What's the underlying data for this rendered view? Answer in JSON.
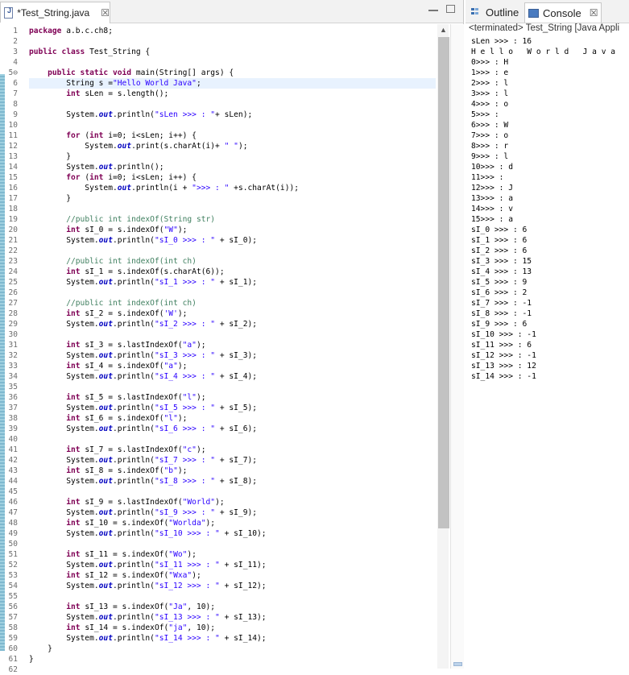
{
  "editor": {
    "tab_title": "*Test_String.java",
    "tab_close": "☒",
    "line_numbers": [
      "1",
      "2",
      "3",
      "4",
      "5⊖",
      "6",
      "7",
      "8",
      "9",
      "10",
      "11",
      "12",
      "13",
      "14",
      "15",
      "16",
      "17",
      "18",
      "19",
      "20",
      "21",
      "22",
      "23",
      "24",
      "25",
      "26",
      "27",
      "28",
      "29",
      "30",
      "31",
      "32",
      "33",
      "34",
      "35",
      "36",
      "37",
      "38",
      "39",
      "40",
      "41",
      "42",
      "43",
      "44",
      "45",
      "46",
      "47",
      "48",
      "49",
      "50",
      "51",
      "52",
      "53",
      "54",
      "55",
      "56",
      "57",
      "58",
      "59",
      "60",
      "61",
      "62"
    ],
    "lines": [
      [
        {
          "t": "package",
          "c": "kw"
        },
        {
          "t": " a.b.c.ch8;"
        }
      ],
      [],
      [
        {
          "t": "public",
          "c": "kw"
        },
        {
          "t": " "
        },
        {
          "t": "class",
          "c": "kw"
        },
        {
          "t": " Test_String {"
        }
      ],
      [],
      [
        {
          "t": "    "
        },
        {
          "t": "public",
          "c": "kw"
        },
        {
          "t": " "
        },
        {
          "t": "static",
          "c": "kw"
        },
        {
          "t": " "
        },
        {
          "t": "void",
          "c": "kw"
        },
        {
          "t": " main(String[] args) {"
        }
      ],
      [
        {
          "t": "        String s ="
        },
        {
          "t": "\"Hello World Java\"",
          "c": "str"
        },
        {
          "t": ";"
        }
      ],
      [
        {
          "t": "        "
        },
        {
          "t": "int",
          "c": "kw"
        },
        {
          "t": " sLen = s.length();"
        }
      ],
      [],
      [
        {
          "t": "        System."
        },
        {
          "t": "out",
          "c": "it"
        },
        {
          "t": ".println("
        },
        {
          "t": "\"sLen >>> : \"",
          "c": "str"
        },
        {
          "t": "+ sLen);"
        }
      ],
      [],
      [
        {
          "t": "        "
        },
        {
          "t": "for",
          "c": "kw"
        },
        {
          "t": " ("
        },
        {
          "t": "int",
          "c": "kw"
        },
        {
          "t": " i=0; i<sLen; i++) {"
        }
      ],
      [
        {
          "t": "            System."
        },
        {
          "t": "out",
          "c": "it"
        },
        {
          "t": ".print(s.charAt(i)+ "
        },
        {
          "t": "\" \"",
          "c": "str"
        },
        {
          "t": ");"
        }
      ],
      [
        {
          "t": "        }"
        }
      ],
      [
        {
          "t": "        System."
        },
        {
          "t": "out",
          "c": "it"
        },
        {
          "t": ".println();"
        }
      ],
      [
        {
          "t": "        "
        },
        {
          "t": "for",
          "c": "kw"
        },
        {
          "t": " ("
        },
        {
          "t": "int",
          "c": "kw"
        },
        {
          "t": " i=0; i<sLen; i++) {"
        }
      ],
      [
        {
          "t": "            System."
        },
        {
          "t": "out",
          "c": "it"
        },
        {
          "t": ".println(i + "
        },
        {
          "t": "\">>> : \"",
          "c": "str"
        },
        {
          "t": " +s.charAt(i));"
        }
      ],
      [
        {
          "t": "        }"
        }
      ],
      [],
      [
        {
          "t": "        "
        },
        {
          "t": "//public int indexOf(String str)",
          "c": "cm"
        }
      ],
      [
        {
          "t": "        "
        },
        {
          "t": "int",
          "c": "kw"
        },
        {
          "t": " sI_0 = s.indexOf("
        },
        {
          "t": "\"W\"",
          "c": "str"
        },
        {
          "t": ");"
        }
      ],
      [
        {
          "t": "        System."
        },
        {
          "t": "out",
          "c": "it"
        },
        {
          "t": ".println("
        },
        {
          "t": "\"sI_0 >>> : \"",
          "c": "str"
        },
        {
          "t": " + sI_0);"
        }
      ],
      [],
      [
        {
          "t": "        "
        },
        {
          "t": "//public int indexOf(int ch)",
          "c": "cm"
        }
      ],
      [
        {
          "t": "        "
        },
        {
          "t": "int",
          "c": "kw"
        },
        {
          "t": " sI_1 = s.indexOf(s.charAt(6));"
        }
      ],
      [
        {
          "t": "        System."
        },
        {
          "t": "out",
          "c": "it"
        },
        {
          "t": ".println("
        },
        {
          "t": "\"sI_1 >>> : \"",
          "c": "str"
        },
        {
          "t": " + sI_1);"
        }
      ],
      [],
      [
        {
          "t": "        "
        },
        {
          "t": "//public int indexOf(int ch)",
          "c": "cm"
        }
      ],
      [
        {
          "t": "        "
        },
        {
          "t": "int",
          "c": "kw"
        },
        {
          "t": " sI_2 = s.indexOf("
        },
        {
          "t": "'W'",
          "c": "str"
        },
        {
          "t": ");"
        }
      ],
      [
        {
          "t": "        System."
        },
        {
          "t": "out",
          "c": "it"
        },
        {
          "t": ".println("
        },
        {
          "t": "\"sI_2 >>> : \"",
          "c": "str"
        },
        {
          "t": " + sI_2);"
        }
      ],
      [],
      [
        {
          "t": "        "
        },
        {
          "t": "int",
          "c": "kw"
        },
        {
          "t": " sI_3 = s.lastIndexOf("
        },
        {
          "t": "\"a\"",
          "c": "str"
        },
        {
          "t": ");"
        }
      ],
      [
        {
          "t": "        System."
        },
        {
          "t": "out",
          "c": "it"
        },
        {
          "t": ".println("
        },
        {
          "t": "\"sI_3 >>> : \"",
          "c": "str"
        },
        {
          "t": " + sI_3);"
        }
      ],
      [
        {
          "t": "        "
        },
        {
          "t": "int",
          "c": "kw"
        },
        {
          "t": " sI_4 = s.indexOf("
        },
        {
          "t": "\"a\"",
          "c": "str"
        },
        {
          "t": ");"
        }
      ],
      [
        {
          "t": "        System."
        },
        {
          "t": "out",
          "c": "it"
        },
        {
          "t": ".println("
        },
        {
          "t": "\"sI_4 >>> : \"",
          "c": "str"
        },
        {
          "t": " + sI_4);"
        }
      ],
      [],
      [
        {
          "t": "        "
        },
        {
          "t": "int",
          "c": "kw"
        },
        {
          "t": " sI_5 = s.lastIndexOf("
        },
        {
          "t": "\"l\"",
          "c": "str"
        },
        {
          "t": ");"
        }
      ],
      [
        {
          "t": "        System."
        },
        {
          "t": "out",
          "c": "it"
        },
        {
          "t": ".println("
        },
        {
          "t": "\"sI_5 >>> : \"",
          "c": "str"
        },
        {
          "t": " + sI_5);"
        }
      ],
      [
        {
          "t": "        "
        },
        {
          "t": "int",
          "c": "kw"
        },
        {
          "t": " sI_6 = s.indexOf("
        },
        {
          "t": "\"l\"",
          "c": "str"
        },
        {
          "t": ");"
        }
      ],
      [
        {
          "t": "        System."
        },
        {
          "t": "out",
          "c": "it"
        },
        {
          "t": ".println("
        },
        {
          "t": "\"sI_6 >>> : \"",
          "c": "str"
        },
        {
          "t": " + sI_6);"
        }
      ],
      [],
      [
        {
          "t": "        "
        },
        {
          "t": "int",
          "c": "kw"
        },
        {
          "t": " sI_7 = s.lastIndexOf("
        },
        {
          "t": "\"c\"",
          "c": "str"
        },
        {
          "t": ");"
        }
      ],
      [
        {
          "t": "        System."
        },
        {
          "t": "out",
          "c": "it"
        },
        {
          "t": ".println("
        },
        {
          "t": "\"sI_7 >>> : \"",
          "c": "str"
        },
        {
          "t": " + sI_7);"
        }
      ],
      [
        {
          "t": "        "
        },
        {
          "t": "int",
          "c": "kw"
        },
        {
          "t": " sI_8 = s.indexOf("
        },
        {
          "t": "\"b\"",
          "c": "str"
        },
        {
          "t": ");"
        }
      ],
      [
        {
          "t": "        System."
        },
        {
          "t": "out",
          "c": "it"
        },
        {
          "t": ".println("
        },
        {
          "t": "\"sI_8 >>> : \"",
          "c": "str"
        },
        {
          "t": " + sI_8);"
        }
      ],
      [],
      [
        {
          "t": "        "
        },
        {
          "t": "int",
          "c": "kw"
        },
        {
          "t": " sI_9 = s.lastIndexOf("
        },
        {
          "t": "\"World\"",
          "c": "str"
        },
        {
          "t": ");"
        }
      ],
      [
        {
          "t": "        System."
        },
        {
          "t": "out",
          "c": "it"
        },
        {
          "t": ".println("
        },
        {
          "t": "\"sI_9 >>> : \"",
          "c": "str"
        },
        {
          "t": " + sI_9);"
        }
      ],
      [
        {
          "t": "        "
        },
        {
          "t": "int",
          "c": "kw"
        },
        {
          "t": " sI_10 = s.indexOf("
        },
        {
          "t": "\"Worlda\"",
          "c": "str"
        },
        {
          "t": ");"
        }
      ],
      [
        {
          "t": "        System."
        },
        {
          "t": "out",
          "c": "it"
        },
        {
          "t": ".println("
        },
        {
          "t": "\"sI_10 >>> : \"",
          "c": "str"
        },
        {
          "t": " + sI_10);"
        }
      ],
      [],
      [
        {
          "t": "        "
        },
        {
          "t": "int",
          "c": "kw"
        },
        {
          "t": " sI_11 = s.indexOf("
        },
        {
          "t": "\"Wo\"",
          "c": "str"
        },
        {
          "t": ");"
        }
      ],
      [
        {
          "t": "        System."
        },
        {
          "t": "out",
          "c": "it"
        },
        {
          "t": ".println("
        },
        {
          "t": "\"sI_11 >>> : \"",
          "c": "str"
        },
        {
          "t": " + sI_11);"
        }
      ],
      [
        {
          "t": "        "
        },
        {
          "t": "int",
          "c": "kw"
        },
        {
          "t": " sI_12 = s.indexOf("
        },
        {
          "t": "\"Wxa\"",
          "c": "str"
        },
        {
          "t": ");"
        }
      ],
      [
        {
          "t": "        System."
        },
        {
          "t": "out",
          "c": "it"
        },
        {
          "t": ".println("
        },
        {
          "t": "\"sI_12 >>> : \"",
          "c": "str"
        },
        {
          "t": " + sI_12);"
        }
      ],
      [],
      [
        {
          "t": "        "
        },
        {
          "t": "int",
          "c": "kw"
        },
        {
          "t": " sI_13 = s.indexOf("
        },
        {
          "t": "\"Ja\"",
          "c": "str"
        },
        {
          "t": ", 10);"
        }
      ],
      [
        {
          "t": "        System."
        },
        {
          "t": "out",
          "c": "it"
        },
        {
          "t": ".println("
        },
        {
          "t": "\"sI_13 >>> : \"",
          "c": "str"
        },
        {
          "t": " + sI_13);"
        }
      ],
      [
        {
          "t": "        "
        },
        {
          "t": "int",
          "c": "kw"
        },
        {
          "t": " sI_14 = s.indexOf("
        },
        {
          "t": "\"ja\"",
          "c": "str"
        },
        {
          "t": ", 10);"
        }
      ],
      [
        {
          "t": "        System."
        },
        {
          "t": "out",
          "c": "it"
        },
        {
          "t": ".println("
        },
        {
          "t": "\"sI_14 >>> : \"",
          "c": "str"
        },
        {
          "t": " + sI_14);"
        }
      ],
      [
        {
          "t": "    }"
        }
      ],
      [
        {
          "t": "}"
        }
      ],
      []
    ],
    "current_line": 6
  },
  "side": {
    "outline_tab": "Outline",
    "console_tab": "Console",
    "console_close": "☒",
    "title": "<terminated> Test_String [Java Appli",
    "output": [
      "sLen >>> : 16",
      "H e l l o   W o r l d   J a v a",
      "0>>> : H",
      "1>>> : e",
      "2>>> : l",
      "3>>> : l",
      "4>>> : o",
      "5>>> :",
      "6>>> : W",
      "7>>> : o",
      "8>>> : r",
      "9>>> : l",
      "10>>> : d",
      "11>>> :",
      "12>>> : J",
      "13>>> : a",
      "14>>> : v",
      "15>>> : a",
      "sI_0 >>> : 6",
      "sI_1 >>> : 6",
      "sI_2 >>> : 6",
      "sI_3 >>> : 15",
      "sI_4 >>> : 13",
      "sI_5 >>> : 9",
      "sI_6 >>> : 2",
      "sI_7 >>> : -1",
      "sI_8 >>> : -1",
      "sI_9 >>> : 6",
      "sI_10 >>> : -1",
      "sI_11 >>> : 6",
      "sI_12 >>> : -1",
      "sI_13 >>> : 12",
      "sI_14 >>> : -1"
    ]
  }
}
